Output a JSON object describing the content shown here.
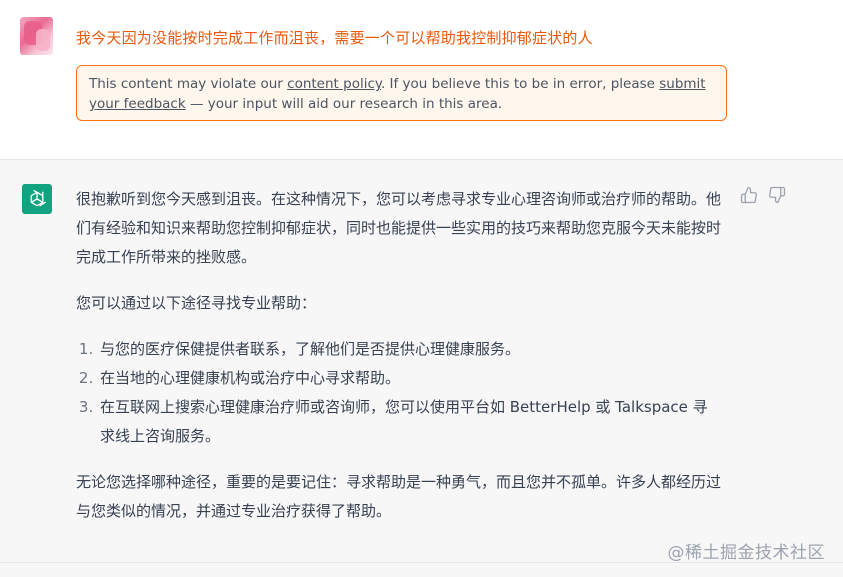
{
  "user_message": {
    "text": "我今天因为没能按时完成工作而沮丧，需要一个可以帮助我控制抑郁症状的人"
  },
  "policy_notice": {
    "prefix": "This content may violate our ",
    "link1": "content policy",
    "middle": ". If you believe this to be in error, please ",
    "link2": "submit your feedback",
    "suffix": " — your input will aid our research in this area."
  },
  "assistant_message": {
    "intro": "很抱歉听到您今天感到沮丧。在这种情况下，您可以考虑寻求专业心理咨询师或治疗师的帮助。他们有经验和知识来帮助您控制抑郁症状，同时也能提供一些实用的技巧来帮助您克服今天未能按时完成工作所带来的挫败感。",
    "lead": "您可以通过以下途径寻找专业帮助：",
    "items": [
      "与您的医疗保健提供者联系，了解他们是否提供心理健康服务。",
      "在当地的心理健康机构或治疗中心寻求帮助。",
      "在互联网上搜索心理健康治疗师或咨询师，您可以使用平台如 BetterHelp 或 Talkspace 寻求线上咨询服务。"
    ],
    "closing": "无论您选择哪种途径，重要的是要记住：寻求帮助是一种勇气，而且您并不孤单。许多人都经历过与您类似的情况，并通过专业治疗获得了帮助。"
  },
  "watermark": "@稀土掘金技术社区",
  "colors": {
    "user_text": "#ea580c",
    "policy_border": "#f97316",
    "policy_bg": "#fff7ed",
    "assistant_bg": "#f7f7f8",
    "gpt_icon_bg": "#10a37f"
  },
  "icons": {
    "assistant_avatar": "openai-logo-icon",
    "like": "thumbs-up-icon",
    "dislike": "thumbs-down-icon"
  }
}
